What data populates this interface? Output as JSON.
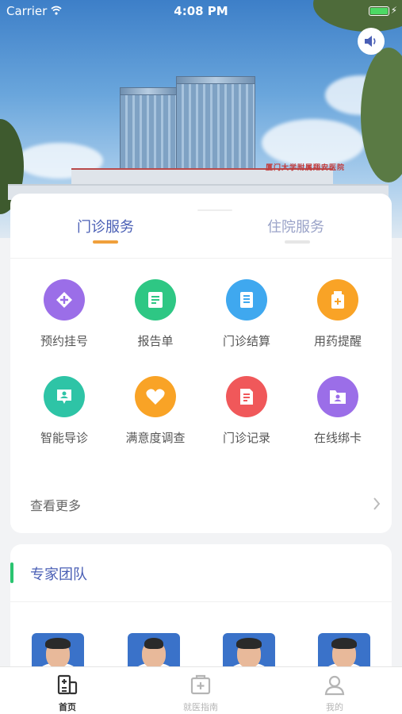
{
  "status_bar": {
    "carrier": "Carrier",
    "time": "4:08 PM"
  },
  "hero": {
    "building_sign": "厦门大学附属翔安医院"
  },
  "service_tabs": [
    {
      "label": "门诊服务",
      "active": true
    },
    {
      "label": "住院服务",
      "active": false
    }
  ],
  "services": [
    {
      "label": "预约挂号",
      "icon": "plus-icon",
      "color": "#9b6ee8"
    },
    {
      "label": "报告单",
      "icon": "report-icon",
      "color": "#2ec784"
    },
    {
      "label": "门诊结算",
      "icon": "billing-icon",
      "color": "#3fa8ef"
    },
    {
      "label": "用药提醒",
      "icon": "medicine-icon",
      "color": "#f9a326"
    },
    {
      "label": "智能导诊",
      "icon": "guide-icon",
      "color": "#2ec4a6"
    },
    {
      "label": "满意度调查",
      "icon": "heart-icon",
      "color": "#f9a326"
    },
    {
      "label": "门诊记录",
      "icon": "record-icon",
      "color": "#f0585a"
    },
    {
      "label": "在线绑卡",
      "icon": "card-bind-icon",
      "color": "#9b6ee8"
    }
  ],
  "more": {
    "label": "查看更多"
  },
  "expert": {
    "title": "专家团队"
  },
  "tab_bar": [
    {
      "label": "首页",
      "icon": "hospital-icon",
      "active": true
    },
    {
      "label": "就医指南",
      "icon": "guide-box-icon",
      "active": false
    },
    {
      "label": "我的",
      "icon": "user-icon",
      "active": false
    }
  ],
  "colors": {
    "accent": "#4a5fb5",
    "indicator": "#f0a03c",
    "expert_bar": "#2ac470"
  }
}
